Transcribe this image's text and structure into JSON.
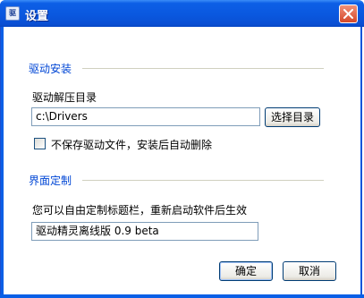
{
  "window": {
    "title": "设置",
    "icon_label": "驱"
  },
  "driver_install": {
    "section_title": "驱动安装",
    "dir_label": "驱动解压目录",
    "dir_value": "c:\\Drivers",
    "browse_button": "选择目录",
    "checkbox_label": "不保存驱动文件，安装后自动删除",
    "checkbox_checked": false
  },
  "ui_customization": {
    "section_title": "界面定制",
    "hint": "您可以自由定制标题栏，重新启动软件后生效",
    "title_value": "驱动精灵离线版 0.9 beta"
  },
  "buttons": {
    "ok": "确定",
    "cancel": "取消"
  },
  "colors": {
    "title_bar": "#0a58df",
    "section_title": "#0046d5",
    "close_button": "#d4482a"
  },
  "icons": {
    "app": "driver-genius-icon",
    "close": "close-icon"
  }
}
